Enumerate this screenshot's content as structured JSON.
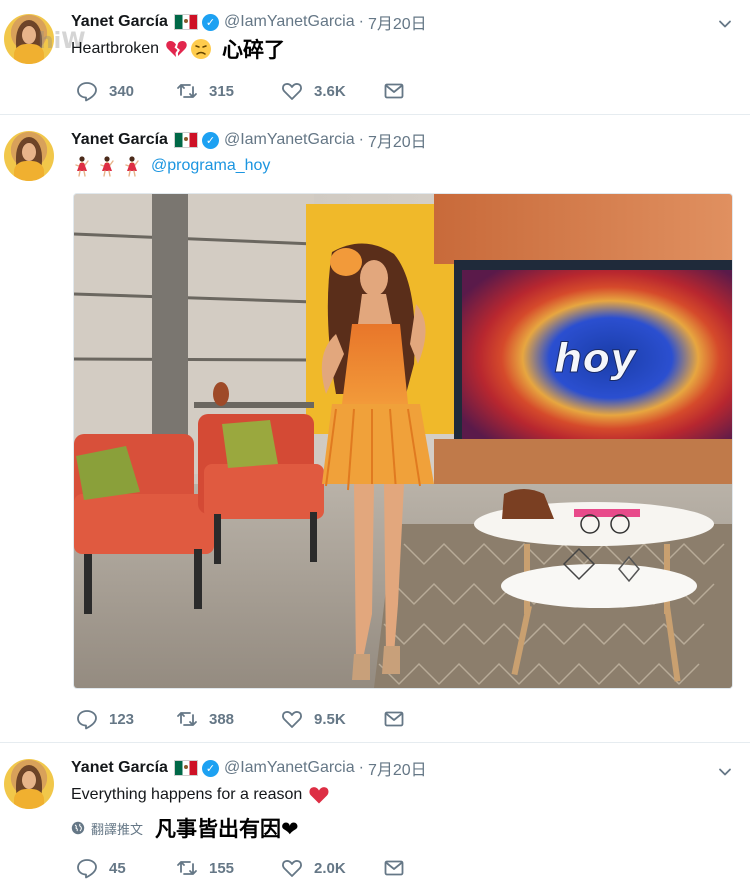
{
  "tweets": [
    {
      "name": "Yanet García",
      "handle": "@IamYanetGarcia",
      "separator": "·",
      "time": "7月20日",
      "text": "Heartbroken",
      "emojis": [
        "broken-heart-emoji",
        "disappointed-face-emoji"
      ],
      "translation_inline": "心碎了",
      "actions": {
        "replies": "340",
        "retweets": "315",
        "likes": "3.6K"
      }
    },
    {
      "name": "Yanet García",
      "handle": "@IamYanetGarcia",
      "separator": "·",
      "time": "7月20日",
      "emojis": [
        "dancer-emoji",
        "dancer-emoji",
        "dancer-emoji"
      ],
      "mention": "@programa_hoy",
      "media": {
        "screen_text": "hoy",
        "description_icon": "photo-tv-studio"
      },
      "actions": {
        "replies": "123",
        "retweets": "388",
        "likes": "9.5K"
      }
    },
    {
      "name": "Yanet García",
      "handle": "@IamYanetGarcia",
      "separator": "·",
      "time": "7月20日",
      "text": "Everything happens for a reason",
      "emojis": [
        "red-heart-emoji"
      ],
      "translate_label": "翻譯推文",
      "translation": "凡事皆出有因❤",
      "actions": {
        "replies": "45",
        "retweets": "155",
        "likes": "2.0K"
      }
    }
  ],
  "colors": {
    "handle_gray": "#657786",
    "link_blue": "#1b95e0",
    "verified_blue": "#1da1f2",
    "divider": "#e6ecf0"
  }
}
